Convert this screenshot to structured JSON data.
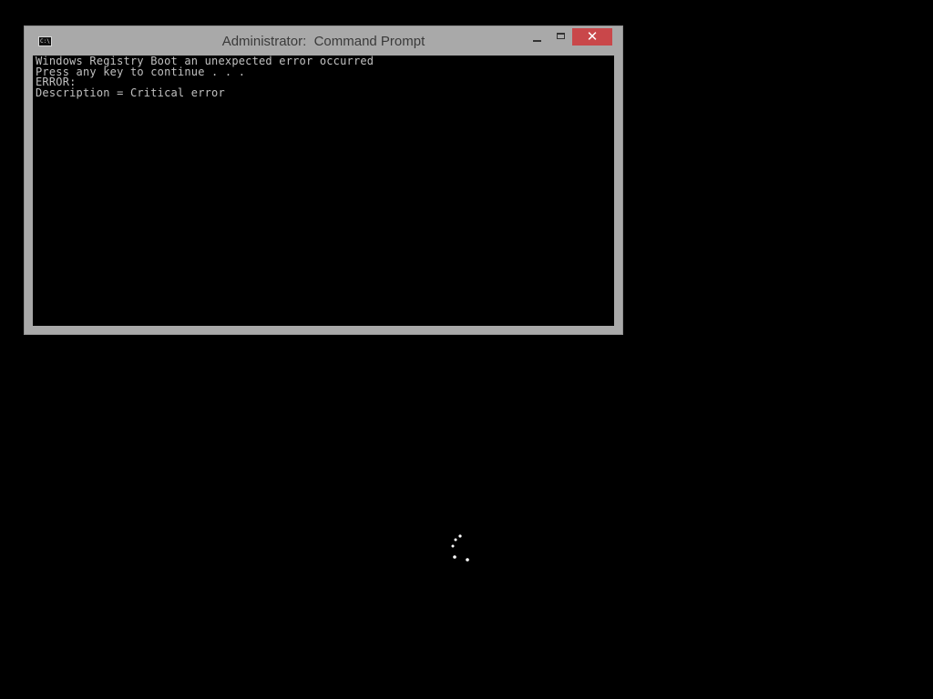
{
  "window": {
    "title": "Administrator:  Command Prompt",
    "icon_name": "cmd-icon",
    "icon_label": "C:\\",
    "close_symbol": "✕"
  },
  "console": {
    "lines": [
      "Windows Registry Boot an unexpected error occurred",
      "Press any key to continue . . .",
      "ERROR:",
      "Description = Critical error"
    ]
  },
  "colors": {
    "background": "#000000",
    "window_frame": "#a9a9a9",
    "close_button": "#c9474a",
    "console_text": "#c0c0c0",
    "logo": "#0c3a40"
  }
}
